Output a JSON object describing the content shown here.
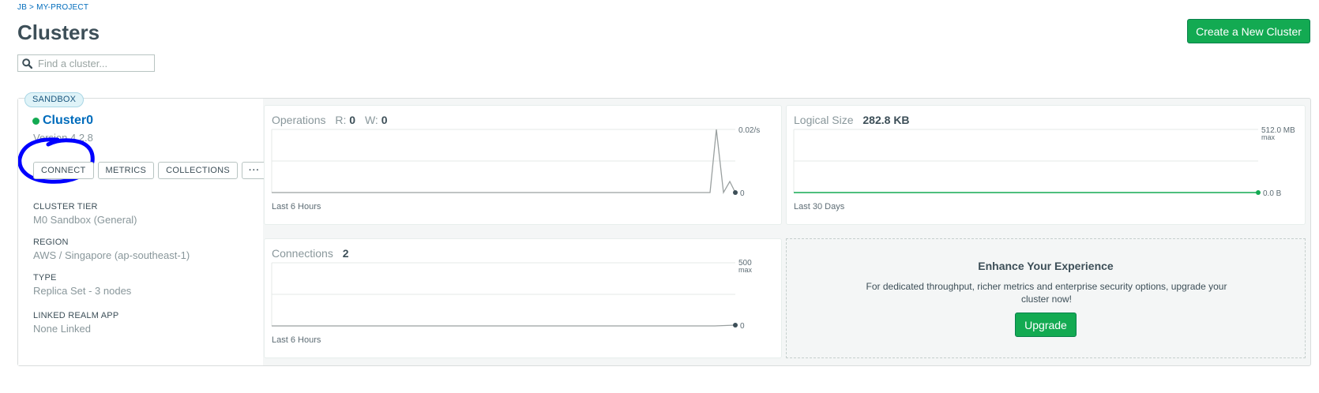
{
  "header": {
    "breadcrumb": "JB > MY-PROJECT",
    "title": "Clusters",
    "search_placeholder": "Find a cluster...",
    "create_button": "Create a New Cluster"
  },
  "cluster": {
    "badge": "SANDBOX",
    "name": "Cluster0",
    "status": "running",
    "version": "Version 4.2.8",
    "buttons": {
      "connect": "CONNECT",
      "metrics": "METRICS",
      "collections": "COLLECTIONS",
      "more": "···"
    },
    "info": [
      {
        "label": "CLUSTER TIER",
        "value": "M0 Sandbox (General)"
      },
      {
        "label": "REGION",
        "value": "AWS / Singapore (ap-southeast-1)"
      },
      {
        "label": "TYPE",
        "value": "Replica Set - 3 nodes"
      },
      {
        "label": "LINKED REALM APP",
        "value": "None Linked"
      }
    ]
  },
  "operations": {
    "title": "Operations",
    "r_label": "R:",
    "r_value": "0",
    "w_label": "W:",
    "w_value": "0",
    "max_label": "0.02/s",
    "min_label": "0",
    "footer": "Last 6 Hours"
  },
  "logical_size": {
    "title": "Logical Size",
    "value": "282.8 KB",
    "max_label": "512.0 MB",
    "max_sub": "max",
    "min_label": "0.0 B",
    "footer": "Last 30 Days"
  },
  "connections": {
    "title": "Connections",
    "value": "2",
    "max_label": "500",
    "max_sub": "max",
    "min_label": "0",
    "footer": "Last 6 Hours"
  },
  "upgrade": {
    "title": "Enhance Your Experience",
    "description": "For dedicated throughput, richer metrics and enterprise security options, upgrade your cluster now!",
    "button": "Upgrade"
  },
  "colors": {
    "accent_green": "#13aa52",
    "link_blue": "#006cbc",
    "annotation_blue": "#0000ff"
  },
  "icons": {
    "search": "search-icon",
    "status": "status-dot-icon"
  }
}
